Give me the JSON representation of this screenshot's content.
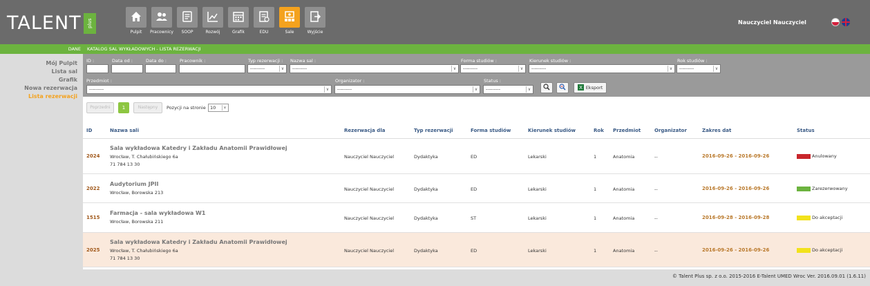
{
  "header": {
    "logo_text": "TALENT",
    "logo_plus": "plus",
    "user_name": "Nauczyciel Nauczyciel",
    "nav": [
      {
        "label": "Pulpit",
        "icon": "home-icon"
      },
      {
        "label": "Pracownicy",
        "icon": "users-icon"
      },
      {
        "label": "SOOP",
        "icon": "form-icon"
      },
      {
        "label": "Rozwój",
        "icon": "chart-icon"
      },
      {
        "label": "Grafik",
        "icon": "calendar-icon"
      },
      {
        "label": "EDU",
        "icon": "document-icon"
      },
      {
        "label": "Sale",
        "icon": "room-icon"
      },
      {
        "label": "Wyjście",
        "icon": "exit-icon"
      }
    ]
  },
  "greenbar": {
    "section": "DANE",
    "breadcrumb": "KATALOG SAL WYKŁADOWYCH - LISTA REZERWACJI"
  },
  "sidebar": {
    "items": [
      "Mój Pulpit",
      "Lista sal",
      "Grafik",
      "Nowa rezerwacja",
      "Lista rezerwacji"
    ]
  },
  "filters": {
    "id_label": "ID :",
    "date_from_label": "Data od :",
    "date_to_label": "Data do :",
    "employee_label": "Pracownik :",
    "res_type_label": "Typ rezerwacji :",
    "room_name_label": "Nazwa sal :",
    "study_form_label": "Forma studiów :",
    "field_label": "Kierunek studiów :",
    "year_label": "Rok studiów :",
    "subject_label": "Przedmiot :",
    "organizer_label": "Organizator :",
    "status_label": "Status :",
    "empty_option": "---------",
    "export_label": "Eksport"
  },
  "pager": {
    "prev": "Poprzedni",
    "current": "1",
    "next": "Następny",
    "per_page_label": "Pozycji na stronie",
    "per_page_value": "10"
  },
  "table": {
    "headers": {
      "id": "ID",
      "name": "Nazwa sali",
      "for": "Rezerwacja dla",
      "type": "Typ rezerwacji",
      "form": "Forma studiów",
      "field": "Kierunek studiów",
      "year": "Rok",
      "subject": "Przedmiot",
      "organizer": "Organizator",
      "dates": "Zakres dat",
      "status": "Status"
    },
    "rows": [
      {
        "id": "2024",
        "name": "Sala wykładowa Katedry i Zakładu Anatomii Prawidłowej",
        "addr": "Wrocław, T. Chałubińskiego 6a",
        "phone": "71 784 13 30",
        "for": "Nauczyciel Nauczyciel",
        "type": "Dydaktyka",
        "form": "ED",
        "field": "Lekarski",
        "year": "1",
        "subject": "Anatomia",
        "organizer": "--",
        "dates": "2016-09-26 - 2016-09-26",
        "status": "Anulowany",
        "status_color": "#c8262b"
      },
      {
        "id": "2022",
        "name": "Audytorium JPII",
        "addr": "Wrocław, Borowska 213",
        "phone": "",
        "for": "Nauczyciel Nauczyciel",
        "type": "Dydaktyka",
        "form": "ED",
        "field": "Lekarski",
        "year": "1",
        "subject": "Anatomia",
        "organizer": "--",
        "dates": "2016-09-26 - 2016-09-26",
        "status": "Zarezerwowany",
        "status_color": "#6cb33f"
      },
      {
        "id": "1515",
        "name": "Farmacja - sala wykładowa W1",
        "addr": "Wrocław, Borowska 211",
        "phone": "",
        "for": "Nauczyciel Nauczyciel",
        "type": "Dydaktyka",
        "form": "ST",
        "field": "Lekarski",
        "year": "1",
        "subject": "Anatomia",
        "organizer": "--",
        "dates": "2016-09-28 - 2016-09-28",
        "status": "Do akceptacji",
        "status_color": "#f2e21c"
      },
      {
        "id": "2025",
        "name": "Sala wykładowa Katedry i Zakładu Anatomii Prawidłowej",
        "addr": "Wrocław, T. Chałubińskiego 6a",
        "phone": "71 784 13 30",
        "for": "Nauczyciel Nauczyciel",
        "type": "Dydaktyka",
        "form": "ED",
        "field": "Lekarski",
        "year": "1",
        "subject": "Anatomia",
        "organizer": "--",
        "dates": "2016-09-26 - 2016-09-26",
        "status": "Do akceptacji",
        "status_color": "#f2e21c"
      }
    ]
  },
  "footer": {
    "text": "© Talent Plus sp. z o.o. 2015-2016   E-Talent UMED Wroc Ver. 2016.09.01 (1.6.11)"
  },
  "colors": {
    "header_bg": "#6b6b6b",
    "accent_green": "#6cb33f",
    "accent_orange": "#f4a21e"
  }
}
